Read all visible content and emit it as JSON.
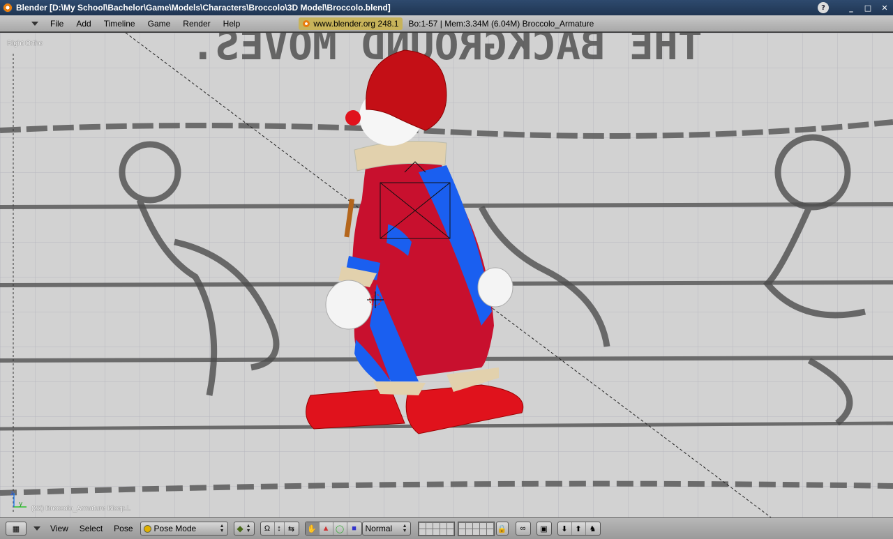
{
  "window": {
    "title": "Blender [D:\\My School\\Bachelor\\Game\\Models\\Characters\\Broccolo\\3D Model\\Broccolo.blend]",
    "buttons": {
      "minimize": "_",
      "maximize": "□",
      "close": "✕",
      "help": "?"
    }
  },
  "menubar": {
    "items": [
      "File",
      "Add",
      "Timeline",
      "Game",
      "Render",
      "Help"
    ],
    "site": "www.blender.org 248.1",
    "stats": "Bo:1-57  | Mem:3.34M (6.04M) Broccolo_Armature"
  },
  "viewport": {
    "view_label": "Right Ortho",
    "object_label": "(22) Broccolo_Armature Bicep.L",
    "background_text": "THE BACKGROUND MOVES."
  },
  "bottombar": {
    "menus": [
      "View",
      "Select",
      "Pose"
    ],
    "mode": "Pose Mode",
    "shading": "Normal"
  },
  "colors": {
    "clown_red": "#d8101c",
    "clown_blue": "#1a5ff0",
    "accent": "#e87d0d"
  }
}
